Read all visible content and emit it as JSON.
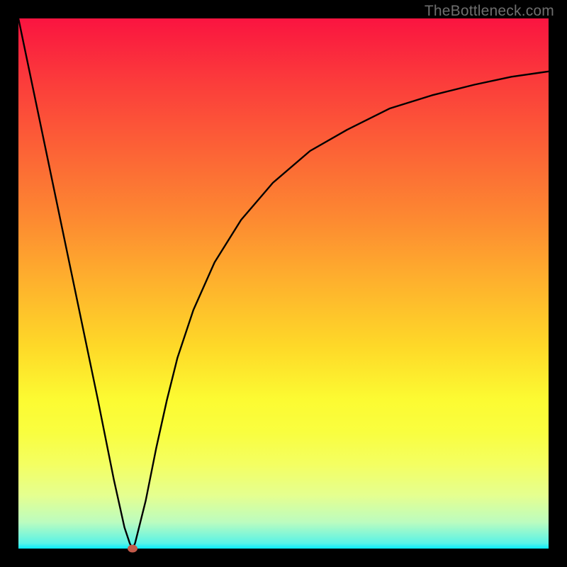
{
  "watermark": "TheBottleneck.com",
  "colors": {
    "background_frame": "#000000",
    "watermark": "#6e6e6e",
    "curve_stroke": "#000000",
    "marker_fill": "#c35a4a",
    "gradient_top": "#fa1440",
    "gradient_bottom": "#06ecfe"
  },
  "chart_data": {
    "type": "line",
    "title": "",
    "xlabel": "",
    "ylabel": "",
    "xlim": [
      0,
      100
    ],
    "ylim": [
      0,
      100
    ],
    "grid": false,
    "legend": false,
    "series": [
      {
        "name": "bottleneck-curve",
        "x": [
          0,
          5,
          10,
          15,
          18,
          20,
          21,
          21.5,
          22,
          24,
          26,
          28,
          30,
          33,
          37,
          42,
          48,
          55,
          62,
          70,
          78,
          86,
          93,
          100
        ],
        "values": [
          100,
          76,
          52,
          28,
          13,
          4,
          1,
          0,
          1,
          9,
          19,
          28,
          36,
          45,
          54,
          62,
          69,
          75,
          79,
          83,
          85.5,
          87.5,
          89,
          90
        ]
      }
    ],
    "marker": {
      "x": 21.5,
      "y": 0
    },
    "background_gradient": {
      "orientation": "vertical_top_to_bottom",
      "stops": [
        {
          "pos": 0.0,
          "color": "#fa1440"
        },
        {
          "pos": 0.12,
          "color": "#fb3c3b"
        },
        {
          "pos": 0.25,
          "color": "#fc6336"
        },
        {
          "pos": 0.38,
          "color": "#fd8a31"
        },
        {
          "pos": 0.5,
          "color": "#feb22d"
        },
        {
          "pos": 0.62,
          "color": "#fed928"
        },
        {
          "pos": 0.72,
          "color": "#fcfb32"
        },
        {
          "pos": 0.78,
          "color": "#f9fe3f"
        },
        {
          "pos": 0.84,
          "color": "#f4ff61"
        },
        {
          "pos": 0.9,
          "color": "#e5ff90"
        },
        {
          "pos": 0.95,
          "color": "#bcfcbf"
        },
        {
          "pos": 0.99,
          "color": "#59f3e7"
        },
        {
          "pos": 1.0,
          "color": "#06ecfe"
        }
      ]
    }
  }
}
